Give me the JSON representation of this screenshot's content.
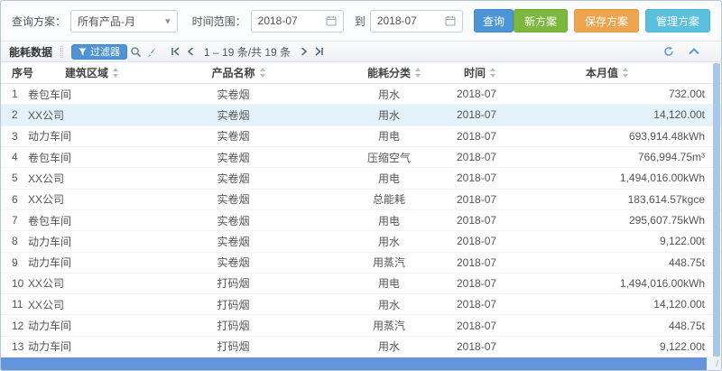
{
  "query_bar": {
    "scheme_label": "查询方案：",
    "scheme_value": "所有产品-月",
    "time_range_label": "时间范围：",
    "date_from": "2018-07",
    "to_label": "到",
    "date_to": "2018-07",
    "search_button": "查询",
    "new_scheme_button": "新方案",
    "save_scheme_button": "保存方案",
    "manage_scheme_button": "管理方案"
  },
  "toolbar": {
    "title": "能耗数据",
    "filter_button": "过滤器",
    "pagination_text": "1 – 19 条/共 19 条"
  },
  "icons": {
    "dropdown_caret": "▾",
    "horizontal_scroll_grip": "/"
  },
  "colors": {
    "accent_blue": "#4e94d4",
    "green": "#7cb83e",
    "orange": "#eda44f",
    "cyan": "#5bc0de",
    "selected_row": "#e4f2fc",
    "hscroll_thumb": "#6394dc",
    "vscroll_thumb": "#a9c8e8"
  },
  "table": {
    "selected_row_index": 1,
    "columns": [
      {
        "key": "index",
        "label": "序号",
        "sortable": false
      },
      {
        "key": "area",
        "label": "建筑区域",
        "sortable": true
      },
      {
        "key": "product",
        "label": "产品名称",
        "sortable": true
      },
      {
        "key": "category",
        "label": "能耗分类",
        "sortable": true
      },
      {
        "key": "time",
        "label": "时间",
        "sortable": true
      },
      {
        "key": "value",
        "label": "本月值",
        "sortable": true
      }
    ],
    "rows": [
      {
        "index": "1",
        "area": "卷包车间",
        "product": "实卷烟",
        "category": "用水",
        "time": "2018-07",
        "value": "732.00t"
      },
      {
        "index": "2",
        "area": "XX公司",
        "product": "实卷烟",
        "category": "用水",
        "time": "2018-07",
        "value": "14,120.00t"
      },
      {
        "index": "3",
        "area": "动力车间",
        "product": "实卷烟",
        "category": "用电",
        "time": "2018-07",
        "value": "693,914.48kWh"
      },
      {
        "index": "4",
        "area": "卷包车间",
        "product": "实卷烟",
        "category": "压缩空气",
        "time": "2018-07",
        "value": "766,994.75m³"
      },
      {
        "index": "5",
        "area": "XX公司",
        "product": "实卷烟",
        "category": "用电",
        "time": "2018-07",
        "value": "1,494,016.00kWh"
      },
      {
        "index": "6",
        "area": "XX公司",
        "product": "实卷烟",
        "category": "总能耗",
        "time": "2018-07",
        "value": "183,614.57kgce"
      },
      {
        "index": "7",
        "area": "卷包车间",
        "product": "实卷烟",
        "category": "用电",
        "time": "2018-07",
        "value": "295,607.75kWh"
      },
      {
        "index": "8",
        "area": "动力车间",
        "product": "实卷烟",
        "category": "用水",
        "time": "2018-07",
        "value": "9,122.00t"
      },
      {
        "index": "9",
        "area": "动力车间",
        "product": "实卷烟",
        "category": "用蒸汽",
        "time": "2018-07",
        "value": "448.75t"
      },
      {
        "index": "10",
        "area": "XX公司",
        "product": "打码烟",
        "category": "用电",
        "time": "2018-07",
        "value": "1,494,016.00kWh"
      },
      {
        "index": "11",
        "area": "XX公司",
        "product": "打码烟",
        "category": "用水",
        "time": "2018-07",
        "value": "14,120.00t"
      },
      {
        "index": "12",
        "area": "动力车间",
        "product": "打码烟",
        "category": "用蒸汽",
        "time": "2018-07",
        "value": "448.75t"
      },
      {
        "index": "13",
        "area": "动力车间",
        "product": "打码烟",
        "category": "用水",
        "time": "2018-07",
        "value": "9,122.00t"
      }
    ]
  }
}
